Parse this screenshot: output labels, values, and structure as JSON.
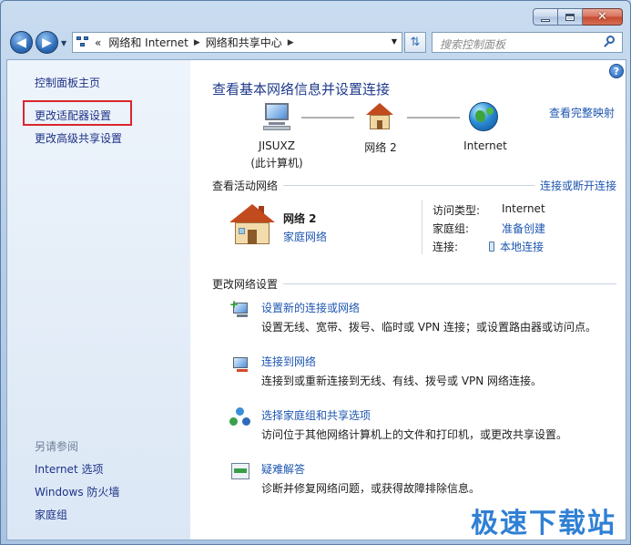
{
  "window": {
    "caption_buttons": {
      "minimize": "minimize",
      "maximize": "maximize",
      "close": "✕"
    }
  },
  "nav": {
    "back_icon": "back-arrow-icon",
    "forward_icon": "forward-arrow-icon",
    "address": {
      "overflow": "«",
      "crumbs": [
        "网络和 Internet",
        "网络和共享中心"
      ]
    },
    "search_placeholder": "搜索控制面板"
  },
  "sidebar": {
    "links": [
      {
        "label": "控制面板主页"
      },
      {
        "label": "更改适配器设置",
        "highlighted": true
      },
      {
        "label": "更改高级共享设置"
      }
    ],
    "see_also_header": "另请参阅",
    "see_also": [
      {
        "label": "Internet 选项"
      },
      {
        "label": "Windows 防火墙"
      },
      {
        "label": "家庭组"
      }
    ]
  },
  "main": {
    "title": "查看基本网络信息并设置连接",
    "full_map_link": "查看完整映射",
    "map": {
      "computer_name": "JISUXZ",
      "computer_sub": "(此计算机)",
      "network_name": "网络  2",
      "internet": "Internet"
    },
    "active_header": "查看活动网络",
    "connect_link": "连接或断开连接",
    "active_network": {
      "name": "网络  2",
      "type": "家庭网络",
      "access_label": "访问类型:",
      "access_value": "Internet",
      "homegroup_label": "家庭组:",
      "homegroup_value": "准备创建",
      "connection_label": "连接:",
      "connection_value": "本地连接"
    },
    "change_header": "更改网络设置",
    "tasks": [
      {
        "icon": "new-connection-icon",
        "title": "设置新的连接或网络",
        "desc": "设置无线、宽带、拨号、临时或 VPN 连接；或设置路由器或访问点。"
      },
      {
        "icon": "connect-network-icon",
        "title": "连接到网络",
        "desc": "连接到或重新连接到无线、有线、拨号或 VPN 网络连接。"
      },
      {
        "icon": "homegroup-sharing-icon",
        "title": "选择家庭组和共享选项",
        "desc": "访问位于其他网络计算机上的文件和打印机，或更改共享设置。"
      },
      {
        "icon": "troubleshoot-icon",
        "title": "疑难解答",
        "desc": "诊断并修复网络问题，或获得故障排除信息。"
      }
    ]
  },
  "watermark": "极速下载站",
  "colors": {
    "link": "#1e56b0",
    "title": "#1e3a8a",
    "highlight_box": "#d9262c"
  }
}
